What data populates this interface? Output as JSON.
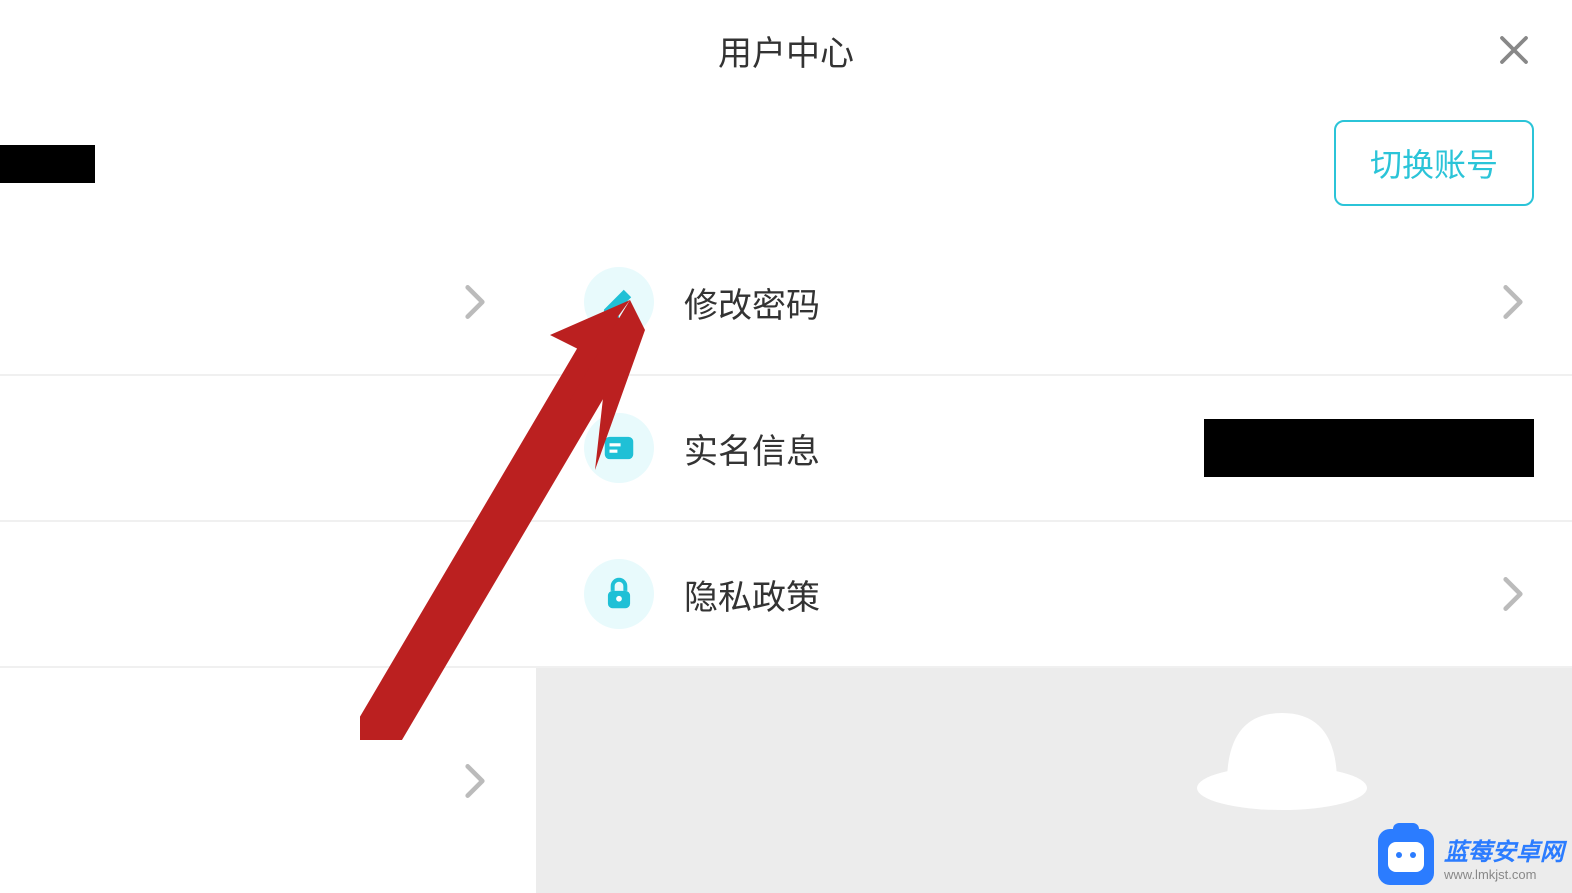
{
  "header": {
    "title": "用户中心"
  },
  "account": {
    "switch_label": "切换账号"
  },
  "menu": {
    "change_password": "修改密码",
    "real_name_info": "实名信息",
    "privacy_policy": "隐私政策"
  },
  "watermark": {
    "name": "蓝莓安卓网",
    "url": "www.lmkjst.com"
  },
  "colors": {
    "accent": "#2bc4d8",
    "arrow": "#bb2020",
    "wm_blue": "#2b7cff"
  }
}
